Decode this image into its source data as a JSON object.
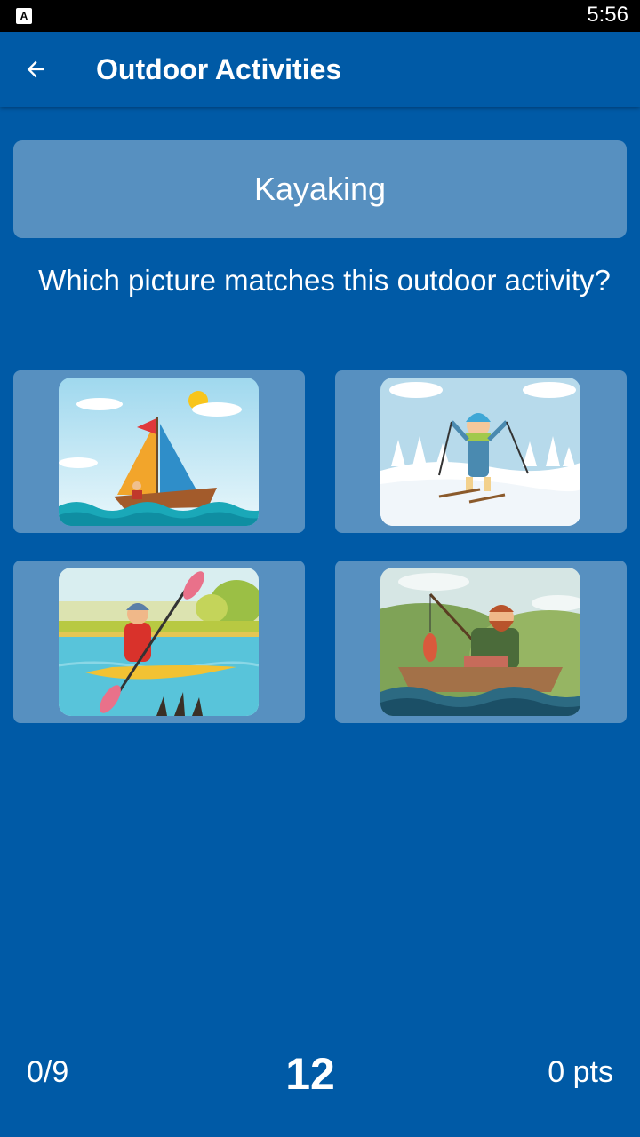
{
  "status_bar": {
    "time": "5:56",
    "app_icon": "A"
  },
  "app_bar": {
    "title": "Outdoor Activities",
    "back_icon": "arrow-left-icon"
  },
  "word_card": {
    "word": "Kayaking"
  },
  "question": "Which picture matches this outdoor activity?",
  "options": [
    {
      "name": "sailboat-picture"
    },
    {
      "name": "skiing-picture"
    },
    {
      "name": "kayaking-picture"
    },
    {
      "name": "fishing-picture"
    }
  ],
  "footer": {
    "progress": "0/9",
    "timer": "12",
    "score": "0 pts"
  },
  "colors": {
    "background": "#005aa6",
    "card": "#5790c0",
    "status_bar": "#000000"
  }
}
